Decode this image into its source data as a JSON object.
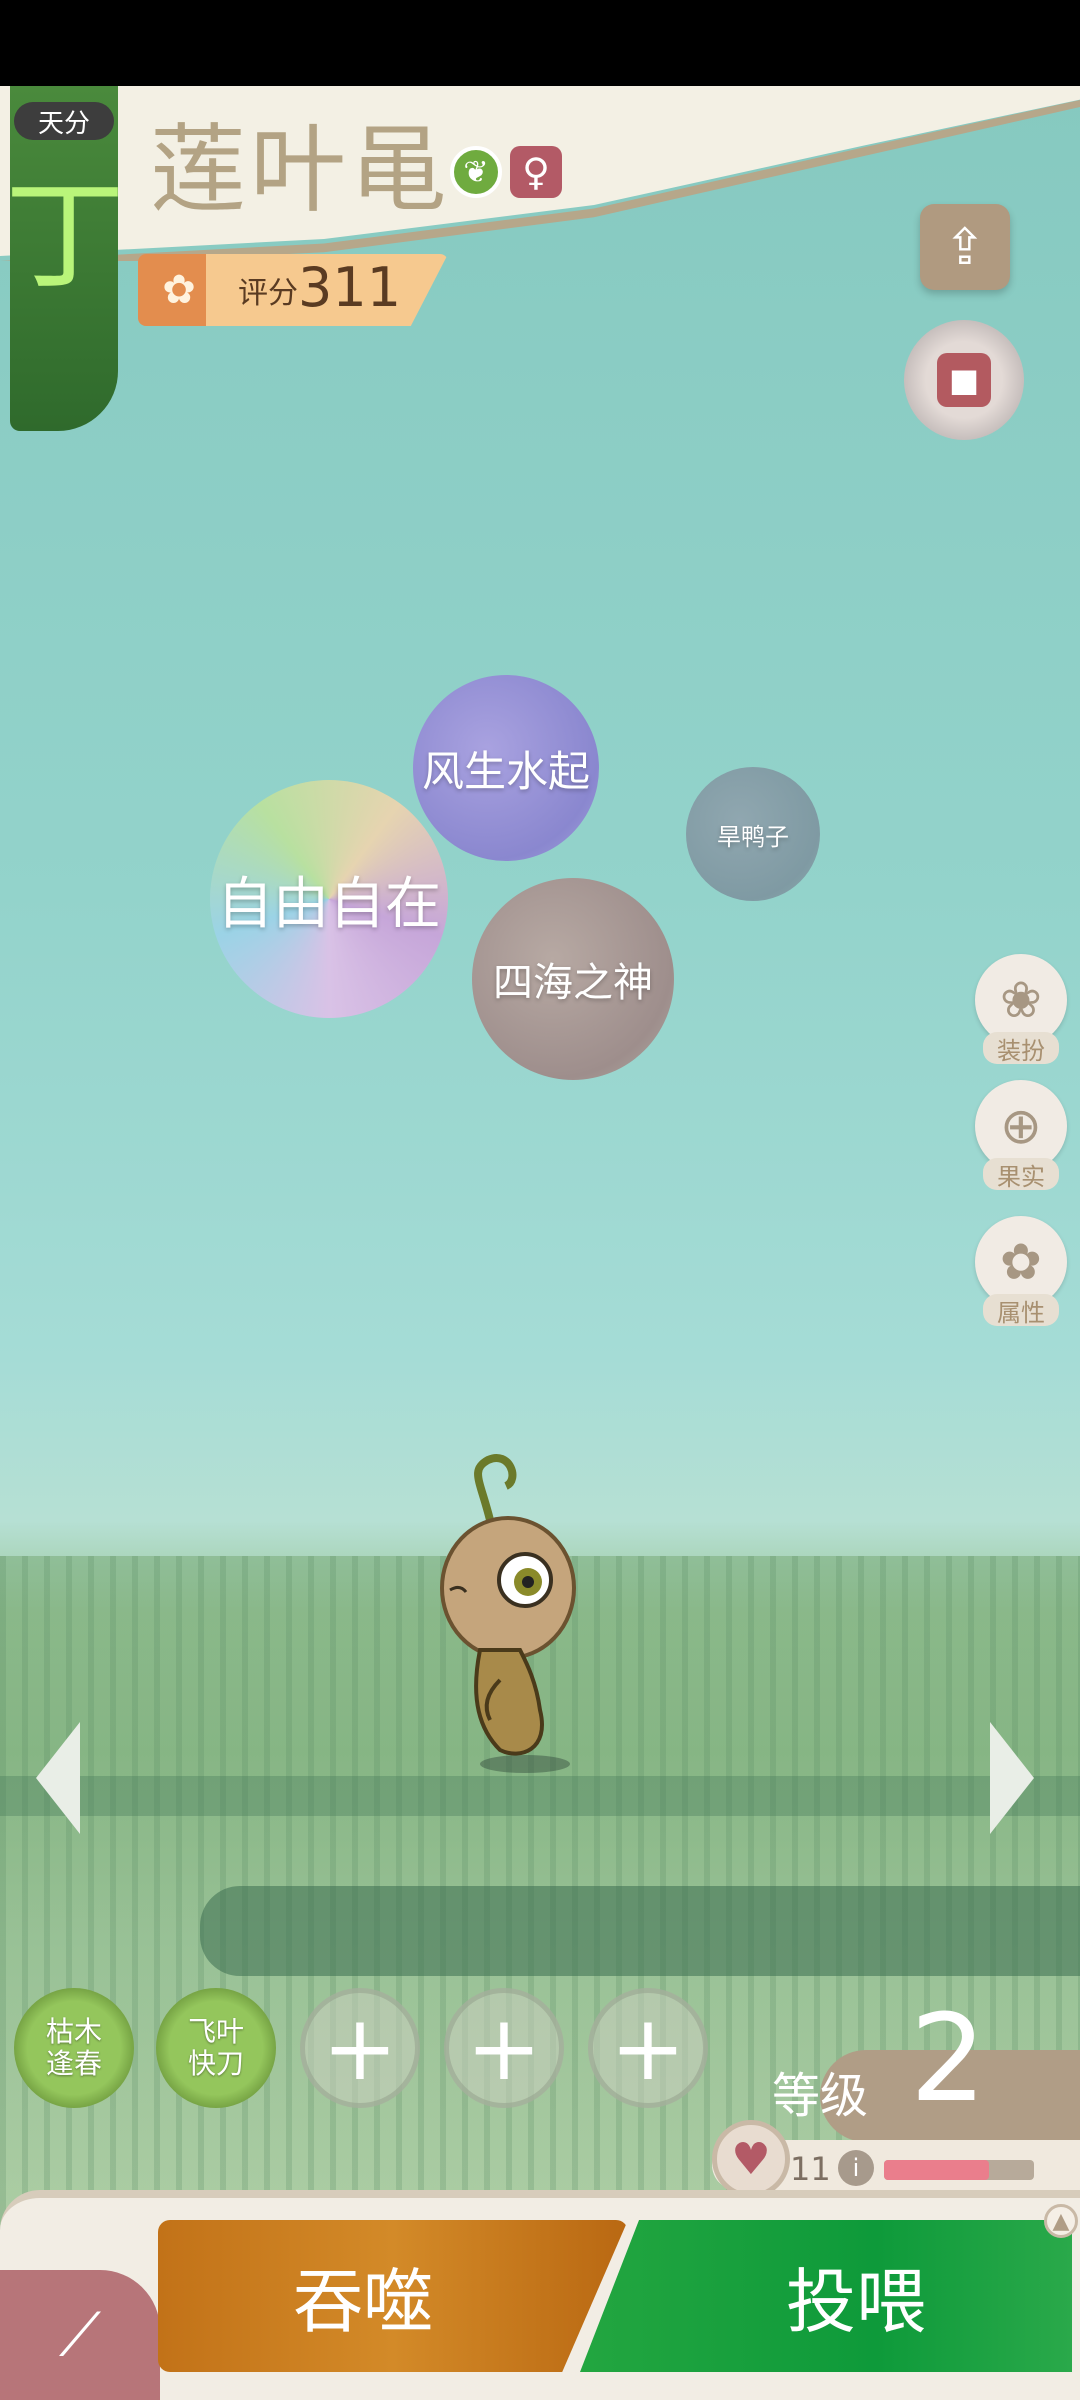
{
  "header": {
    "grade_tag": "天分",
    "grade_letter": "丁",
    "pet_name": "莲叶黾",
    "type_icon": "leaf-element-icon",
    "gender_symbol": "♀",
    "score_label": "评分",
    "score_value": "311"
  },
  "icons": {
    "share": "⇪",
    "lock": "🔒",
    "paw": "✿"
  },
  "bubbles": [
    {
      "label": "风生水起"
    },
    {
      "label": "自由自在"
    },
    {
      "label": "四海之神"
    },
    {
      "label": "旱鸭子"
    }
  ],
  "side_menu": [
    {
      "label": "装扮",
      "icon": "butterfly-icon"
    },
    {
      "label": "果实",
      "icon": "plus-icon"
    },
    {
      "label": "属性",
      "icon": "paw-icon"
    }
  ],
  "skills": [
    {
      "label": "枯木逢春",
      "filled": true
    },
    {
      "label": "飞叶快刀",
      "filled": true
    },
    {
      "label": "+",
      "filled": false
    },
    {
      "label": "+",
      "filled": false
    },
    {
      "label": "+",
      "filled": false
    }
  ],
  "level": {
    "label": "等级",
    "value": "2"
  },
  "hp": {
    "value": "11",
    "fill_fraction": 0.7
  },
  "actions": {
    "devour": "吞噬",
    "feed": "投喂"
  },
  "colors": {
    "feed": "#1aa342",
    "devour": "#c97a1e",
    "accent_brown": "#b09d86"
  }
}
